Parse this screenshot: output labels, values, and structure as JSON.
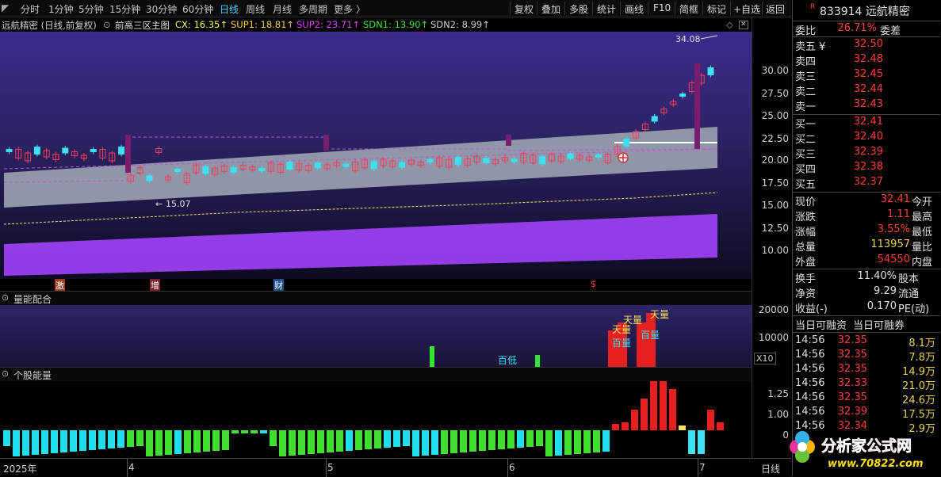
{
  "toolbar": {
    "periods": [
      "分时",
      "1分钟",
      "5分钟",
      "15分钟",
      "30分钟",
      "60分钟",
      "日线",
      "周线",
      "月线",
      "多周期",
      "更多 〉"
    ],
    "active_period": "日线",
    "right_buttons": [
      "复权",
      "叠加",
      "多股",
      "统计",
      "画线",
      "F10",
      "简框",
      "标记",
      "+自选",
      "返回"
    ]
  },
  "indicator_line": {
    "stock": "远航精密 (日线,前复权)",
    "formula": "前高三区主图",
    "cx": "CX: 16.35↑",
    "sup1": "SUP1: 18.81↑",
    "sup2": "SUP2: 23.71↑",
    "sdn1": "SDN1: 13.90↑",
    "sdn2": "SDN2: 8.99↑"
  },
  "main_chart": {
    "high_label": "34.08",
    "low_label": "15.07",
    "y_ticks": [
      "30.00",
      "27.50",
      "25.00",
      "22.50",
      "20.00",
      "17.50",
      "15.00",
      "12.50",
      "10.00"
    ],
    "markers": [
      "激",
      "增",
      "财",
      "$"
    ]
  },
  "volume_panel": {
    "title": "量能配合",
    "y_ticks": [
      "20000",
      "10000"
    ],
    "unit": "X10",
    "annotations": [
      "天量",
      "天量",
      "百量",
      "百量",
      "天量",
      "百低"
    ]
  },
  "ind2_panel": {
    "title": "个股能量",
    "y_ticks": [
      "1.25",
      "1.00",
      "0"
    ]
  },
  "dates": [
    "2025年",
    "4",
    "5",
    "6",
    "7",
    "日线"
  ],
  "quote": {
    "code_name": "833914 远航精密",
    "badge": "R",
    "weibi": "26.71%",
    "weibi_label": "委比",
    "weicha_label": "委差",
    "asks": [
      {
        "label": "卖五 ¥",
        "price": "32.50"
      },
      {
        "label": "卖四",
        "price": "32.48"
      },
      {
        "label": "卖三",
        "price": "32.45"
      },
      {
        "label": "卖二",
        "price": "32.44"
      },
      {
        "label": "卖一",
        "price": "32.43"
      }
    ],
    "bids": [
      {
        "label": "买一",
        "price": "32.41"
      },
      {
        "label": "买二",
        "price": "32.40"
      },
      {
        "label": "买三",
        "price": "32.39"
      },
      {
        "label": "买四",
        "price": "32.38"
      },
      {
        "label": "买五",
        "price": "32.37"
      }
    ],
    "stats": [
      {
        "k": "现价",
        "v": "32.41",
        "k2": "今开"
      },
      {
        "k": "涨跌",
        "v": "1.11",
        "k2": "最高"
      },
      {
        "k": "涨幅",
        "v": "3.55%",
        "k2": "最低"
      },
      {
        "k": "总量",
        "v": "113957",
        "k2": "量比"
      },
      {
        "k": "外盘",
        "v": "54550",
        "k2": "内盘"
      }
    ],
    "stats2": [
      {
        "k": "换手",
        "v": "11.40%",
        "k2": "股本"
      },
      {
        "k": "净资",
        "v": "9.29",
        "k2": "流通"
      },
      {
        "k": "收益(-)",
        "v": "0.170",
        "k2": "PE(动)"
      }
    ],
    "margin_labels": [
      "当日可融资",
      "当日可融券"
    ],
    "ticks": [
      {
        "t": "14:56",
        "p": "32.35",
        "v": "8.1万"
      },
      {
        "t": "14:56",
        "p": "32.35",
        "v": "7.8万"
      },
      {
        "t": "14:56",
        "p": "32.35",
        "v": "14.9万"
      },
      {
        "t": "14:56",
        "p": "32.33",
        "v": "21.0万"
      },
      {
        "t": "14:56",
        "p": "32.35",
        "v": "24.6万"
      },
      {
        "t": "14:56",
        "p": "32.39",
        "v": "17.5万"
      },
      {
        "t": "14:56",
        "p": "32.34",
        "v": "2.9万"
      }
    ]
  },
  "watermark": {
    "title": "分析家公式网",
    "url": "www.70822.com"
  }
}
